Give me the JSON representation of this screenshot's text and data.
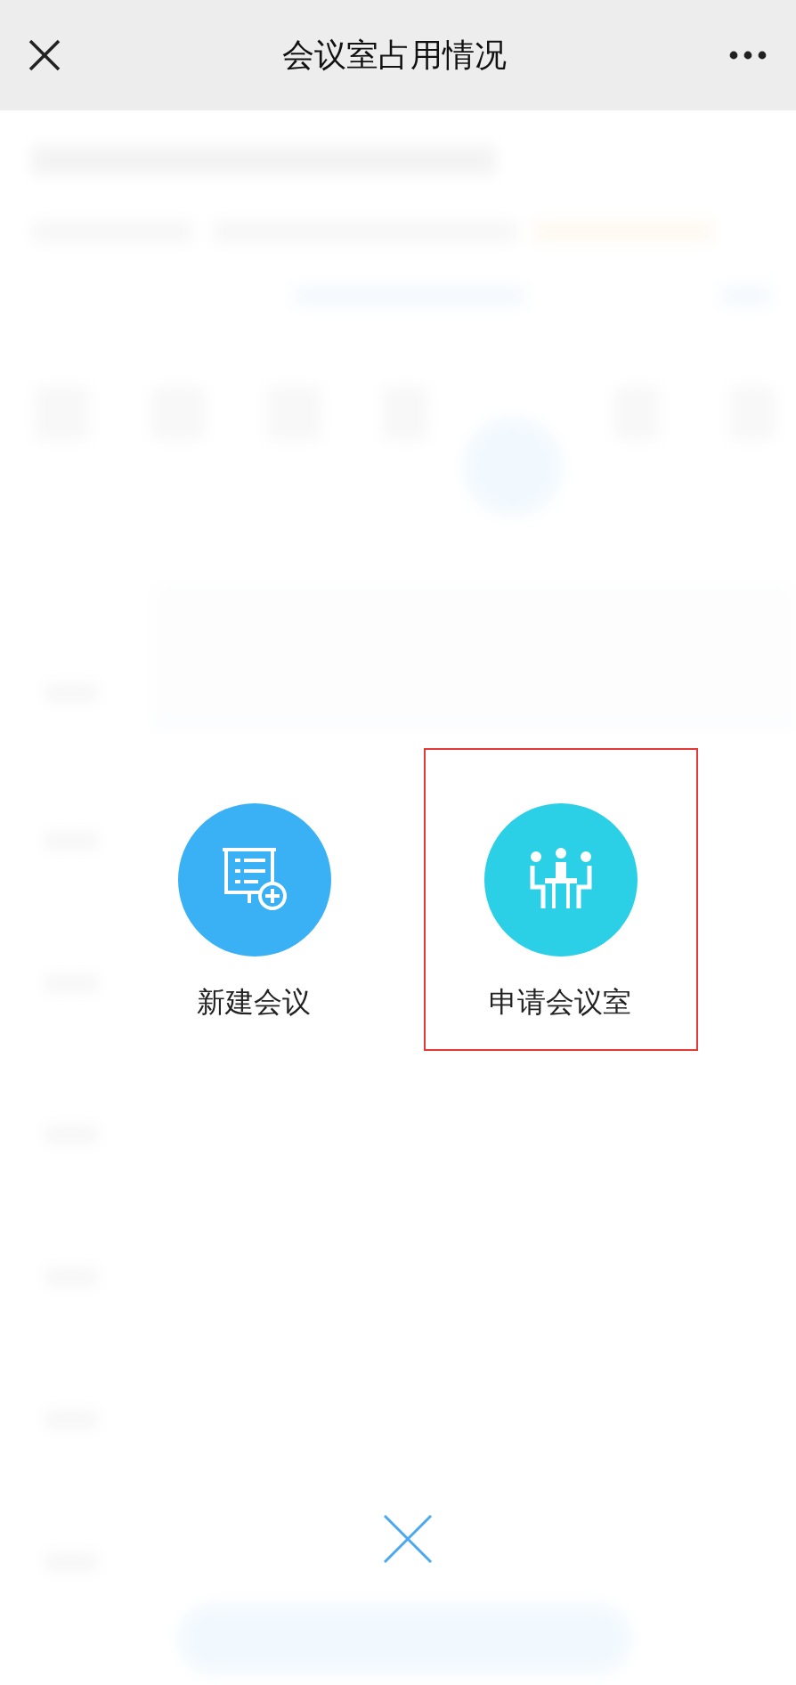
{
  "header": {
    "title": "会议室占用情况"
  },
  "actions": [
    {
      "kind": "new-meeting",
      "label": "新建会议",
      "color": "#3ab0f5",
      "highlighted": false
    },
    {
      "kind": "room",
      "label": "申请会议室",
      "color": "#2bcfe6",
      "highlighted": true
    }
  ]
}
